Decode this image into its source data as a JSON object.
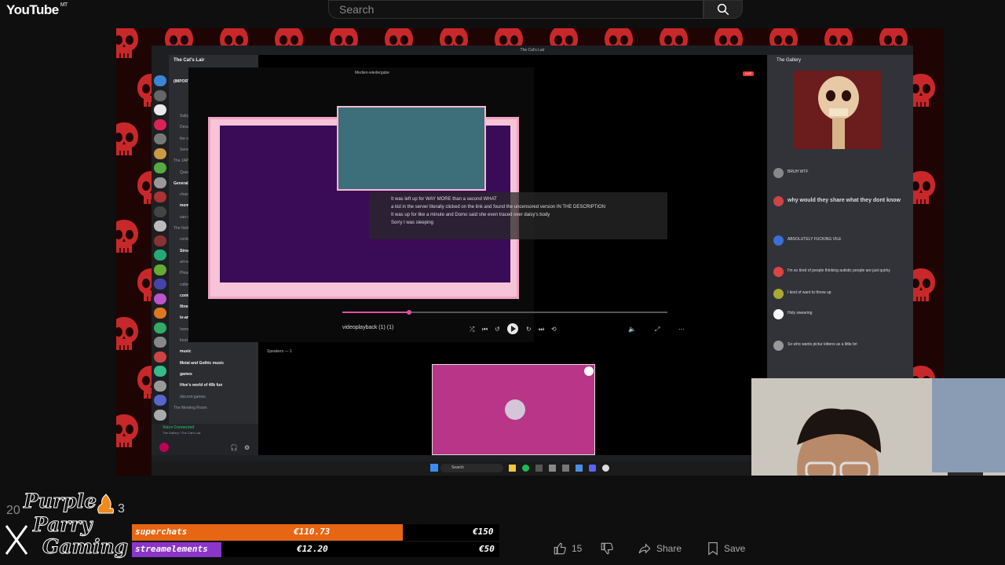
{
  "youtube": {
    "logo": "YouTube",
    "logo_suffix": "MT",
    "search_placeholder": "Search",
    "actions": {
      "like_count": "15",
      "share_label": "Share",
      "save_label": "Save"
    }
  },
  "discord": {
    "window_title": "The Cat's Lair",
    "server_name": "The Cat's Lair",
    "announcement": "(IMPORTANT!) We need to talk.",
    "channels": [
      "Salty Sluts Sal Scribbles",
      "Deranged Splatoon YouTuber vlogs",
      "the nagless dialogues",
      "Server Quotes",
      "The JAPpocalypse/Brollomic",
      "Questions/Criticism For Us",
      "General Community Activity",
      "channel-stuff",
      "memes",
      "sao-stupidity",
      "The Nottslop",
      "content-showcase",
      "Stream Self-Promotion",
      "art-related",
      "Please share your art here",
      "collectors-zone",
      "comics-and-books",
      "fitness-and-health",
      "tv-and-movies",
      "home-ec",
      "food pics",
      "music",
      "Metal and Gothic music",
      "games",
      "Hive's world of 40k fun",
      "discord-games",
      "The Meeting Room"
    ],
    "voice_status": "Voice Connected",
    "voice_channel": "The Gallery / The Cat's Lair",
    "stage": {
      "player_app_title": "Medien-wiedergabe",
      "live_badge": "LIVE",
      "caption_lines": [
        "It was left up for WAY MORE than a second WHAT",
        "a kid in the server literally clicked on the link and found the uncensored version IN THE DESCRIPTION",
        "It was up for like a minute and Domo said she even traced over daisy's body",
        "Sorry I was sleeping"
      ],
      "video_title": "videoplayback (1) (1)",
      "speakers_label": "Speakers — 1"
    },
    "gallery": {
      "title": "The Gallery",
      "messages": [
        {
          "text": "BRUH WTF"
        },
        {
          "text": "why would they share what they dont know"
        },
        {
          "text": "ABSOLUTELY FUCKING VILE"
        },
        {
          "text": "I'm so tired of people thinking autistic people are just quirky"
        },
        {
          "text": "I kind of want to throw up"
        },
        {
          "text": "Holy swearing"
        },
        {
          "text": "So who wants pictur kittens as a little bri"
        }
      ]
    },
    "taskbar": {
      "search_label": "Search"
    }
  },
  "overlay": {
    "brand_line1": "Purple",
    "brand_line2": "Parry",
    "brand_line3": "Gaming",
    "side_number": "20",
    "side_number2": "3",
    "donations": [
      {
        "label": "superchats",
        "amount": "€110.73",
        "goal": "€150",
        "progress": 0.738
      },
      {
        "label": "streamelements",
        "amount": "€12.20",
        "goal": "€50",
        "progress": 0.244
      }
    ]
  },
  "colors": {
    "superchat_fill": "#e66613",
    "streamelements_fill": "#8b35c9",
    "skull_red": "#c8282a",
    "pink_frame": "#f2a3c1"
  }
}
